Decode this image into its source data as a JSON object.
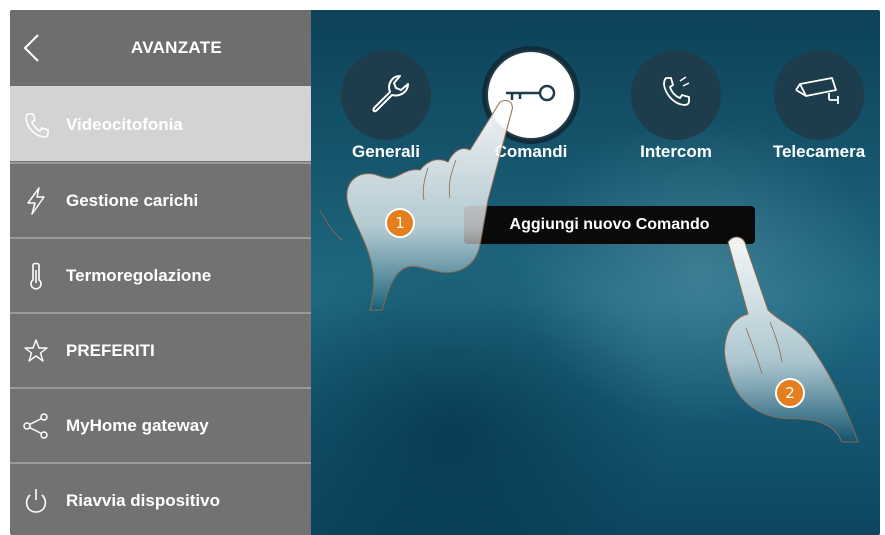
{
  "sidebar": {
    "title": "AVANZATE",
    "items": [
      {
        "label": "Videocitofonia",
        "icon": "phone-handset-icon",
        "active": true
      },
      {
        "label": "Gestione carichi",
        "icon": "lightning-icon",
        "active": false
      },
      {
        "label": "Termoregolazione",
        "icon": "thermometer-icon",
        "active": false
      },
      {
        "label": "PREFERITI",
        "icon": "star-icon",
        "active": false
      },
      {
        "label": "MyHome gateway",
        "icon": "share-icon",
        "active": false
      },
      {
        "label": "Riavvia dispositivo",
        "icon": "power-icon",
        "active": false
      }
    ]
  },
  "categories": [
    {
      "label": "Generali",
      "icon": "wrench-icon",
      "selected": false
    },
    {
      "label": "Comandi",
      "icon": "key-icon",
      "selected": true
    },
    {
      "label": "Intercom",
      "icon": "phone-handset-icon",
      "selected": false
    },
    {
      "label": "Telecamera",
      "icon": "security-camera-icon",
      "selected": false
    }
  ],
  "tooltip": {
    "label": "Aggiungi nuovo Comando"
  },
  "steps": [
    "1",
    "2"
  ],
  "colors": {
    "sidebar": "#727272",
    "active_item": "#d3d3d3",
    "accent": "#e57e1c",
    "background": "#1a5f78"
  }
}
